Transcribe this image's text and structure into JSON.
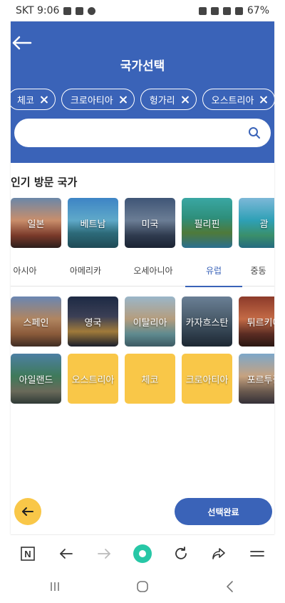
{
  "status_bar": {
    "carrier_time": "SKT 9:06",
    "battery": "67%"
  },
  "header": {
    "title": "국가선택"
  },
  "selected_chips": [
    {
      "label": "체코"
    },
    {
      "label": "크로아티아"
    },
    {
      "label": "헝가리"
    },
    {
      "label": "오스트리아"
    }
  ],
  "search": {
    "value": "",
    "placeholder": ""
  },
  "popular_section": {
    "title": "인기 방문 국가"
  },
  "popular": [
    {
      "label": "일본",
      "bg": "linear-gradient(180deg,#6b87a8 0%,#c98e6b 45%,#7a3a2a 75%,#2c1e1c 100%)"
    },
    {
      "label": "베트남",
      "bg": "linear-gradient(180deg,#3d84c5 0%,#5fa9c9 45%,#2d6b7a 70%,#1f4a55 100%)"
    },
    {
      "label": "미국",
      "bg": "linear-gradient(180deg,#3f5576 0%,#6b7d95 45%,#2f3b4f 75%,#1b2433 100%)"
    },
    {
      "label": "필리핀",
      "bg": "linear-gradient(180deg,#3aa7a3 0%,#2e8f7b 40%,#4f7a3a 70%,#2b6f8f 100%)"
    },
    {
      "label": "괌",
      "bg": "linear-gradient(180deg,#7db8d8 0%,#2ea0b6 45%,#3a8f6a 75%,#256b80 100%)"
    }
  ],
  "tabs": [
    {
      "label": "아시아",
      "active": false
    },
    {
      "label": "아메리카",
      "active": false
    },
    {
      "label": "오세아니아",
      "active": false
    },
    {
      "label": "유럽",
      "active": true
    },
    {
      "label": "중동",
      "active": false
    }
  ],
  "europe_row1": [
    {
      "label": "스페인",
      "bg": "linear-gradient(180deg,#6a86b2 0%,#b08560 45%,#8a5a3a 75%,#3f2c23 100%)"
    },
    {
      "label": "영국",
      "bg": "linear-gradient(180deg,#1d2a44 0%,#3b3f55 40%,#a07a3a 70%,#1a1f2c 100%)"
    },
    {
      "label": "이탈리아",
      "bg": "linear-gradient(180deg,#9ab6c9 0%,#b59d7d 45%,#5f8a8f 75%,#3c5a63 100%)"
    },
    {
      "label": "카자흐스탄",
      "bg": "linear-gradient(180deg,#6a7f95 0%,#4a5c6b 45%,#2f3e4c 75%,#1d2732 100%)"
    },
    {
      "label": "튀르키예",
      "bg": "linear-gradient(180deg,#8c3a2a 0%,#c46b46 45%,#5a2c23 75%,#2b1712 100%)"
    }
  ],
  "europe_row2": [
    {
      "label": "아일랜드",
      "bg": "linear-gradient(180deg,#4c7fa3 0%,#3f7a5a 45%,#6a6a5a 75%,#2f3a36 100%)",
      "selected": false
    },
    {
      "label": "오스트리아",
      "bg": "#f9c748",
      "selected": true
    },
    {
      "label": "체코",
      "bg": "#f9c748",
      "selected": true
    },
    {
      "label": "크로아티아",
      "bg": "#f9c748",
      "selected": true
    },
    {
      "label": "포르투갈",
      "bg": "linear-gradient(180deg,#7da7c9 0%,#c7a27f 45%,#6b5a4f 75%,#343038 100%)",
      "selected": false
    }
  ],
  "actions": {
    "back_icon": "arrow-left-icon",
    "done_label": "선택완료"
  },
  "browser_bar": {
    "icons": [
      "n-logo-icon",
      "back-icon",
      "forward-icon",
      "home-circle-icon",
      "refresh-icon",
      "share-icon",
      "menu-icon"
    ]
  },
  "nav_bar": {
    "icons": [
      "recent-apps-icon",
      "home-icon",
      "back-icon"
    ]
  },
  "colors": {
    "primary": "#3a63b8",
    "accent": "#f9c748",
    "home_circle": "#27c7a6"
  }
}
